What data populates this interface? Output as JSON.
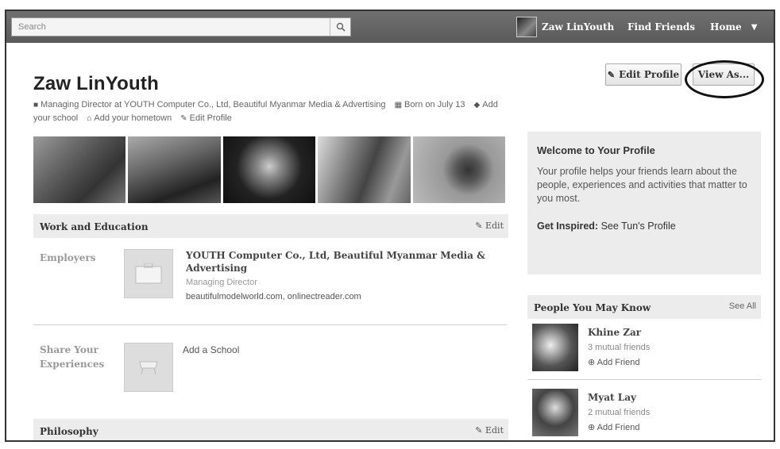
{
  "topbar": {
    "search_placeholder": "Search",
    "user_name": "Zaw LinYouth",
    "find_friends": "Find Friends",
    "home": "Home"
  },
  "profile": {
    "name": "Zaw LinYouth",
    "edit_profile_button": "Edit Profile",
    "view_as_button": "View As...",
    "info_work": "Managing Director at YOUTH Computer Co., Ltd, Beautiful Myanmar Media & Advertising",
    "info_born": "Born on July 13",
    "info_school": "Add your school",
    "info_hometown": "Add your hometown",
    "info_edit": "Edit Profile"
  },
  "work_education": {
    "title": "Work and Education",
    "edit": "Edit",
    "employers_label": "Employers",
    "employer_name": "YOUTH Computer Co., Ltd, Beautiful Myanmar Media & Advertising",
    "employer_role": "Managing Director",
    "employer_sites": "beautifulmodelworld.com, onlinectreader.com",
    "share_label": "Share Your Experiences",
    "add_school": "Add a School"
  },
  "philosophy": {
    "title": "Philosophy",
    "edit": "Edit"
  },
  "welcome": {
    "title": "Welcome to Your Profile",
    "body": "Your profile helps your friends learn about the people, experiences and activities that matter to you most.",
    "inspired_label": "Get Inspired:",
    "inspired_link": "See Tun's Profile"
  },
  "pymk": {
    "title": "People You May Know",
    "see_all": "See All",
    "people": [
      {
        "name": "Khine Zar",
        "mutual": "3 mutual friends",
        "add": "Add Friend"
      },
      {
        "name": "Myat Lay",
        "mutual": "2 mutual friends",
        "add": "Add Friend"
      }
    ]
  },
  "icons": [
    "search-icon",
    "pencil-icon",
    "briefcase-icon",
    "calendar-icon",
    "school-icon",
    "home-icon",
    "add-friend-icon",
    "caret-down-icon"
  ]
}
